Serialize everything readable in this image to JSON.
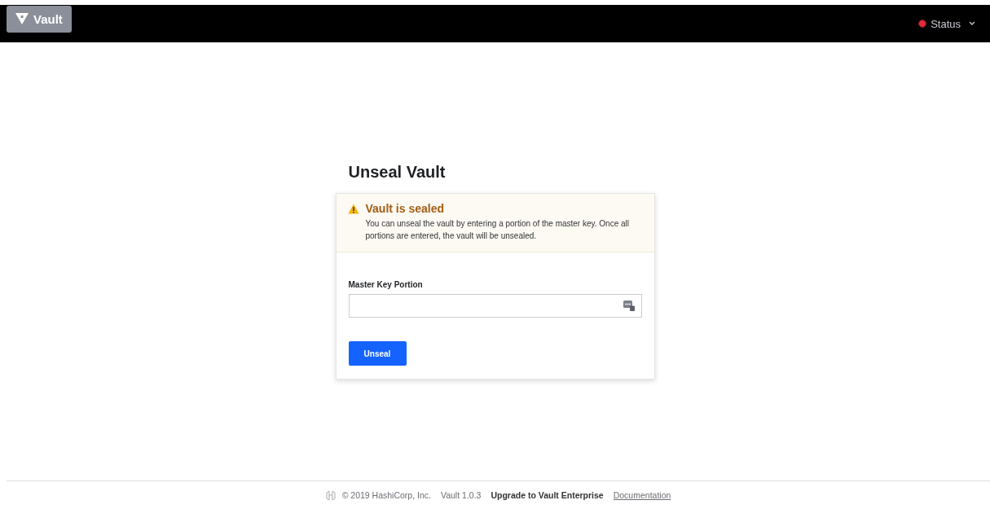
{
  "header": {
    "logo": "Vault",
    "status": "Status"
  },
  "page_title": "Unseal Vault",
  "alert": {
    "title": "Vault is sealed",
    "message": "You can unseal the vault by entering a portion of the master key. Once all portions are entered, the vault will be unsealed."
  },
  "field": {
    "label": "Master Key Portion"
  },
  "submit": "Unseal",
  "footer": {
    "copyright": "© 2019 HashiCorp, Inc.",
    "version": "Vault 1.0.3",
    "upgrade": "Upgrade to Vault Enterprise",
    "docs": "Documentation"
  }
}
